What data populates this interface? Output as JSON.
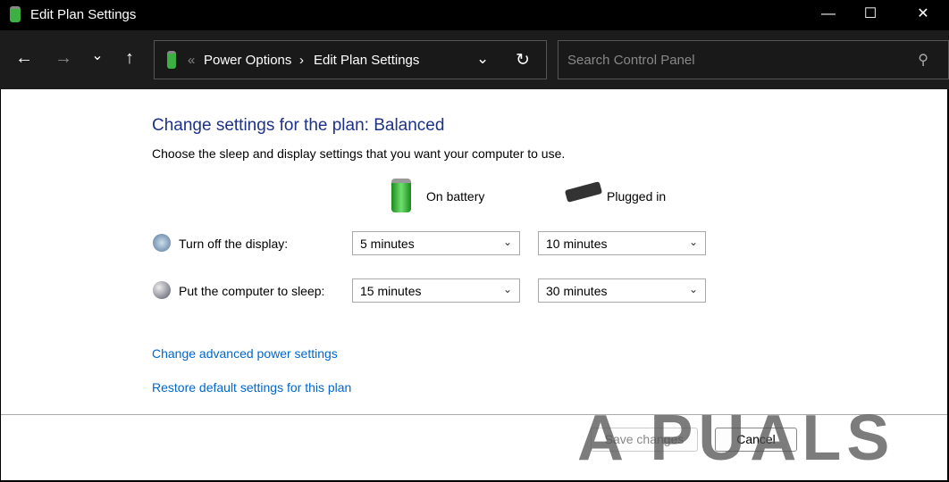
{
  "window": {
    "title": "Edit Plan Settings",
    "minimize": "—",
    "maximize": "☐",
    "close": "✕"
  },
  "nav": {
    "back": "←",
    "forward": "→",
    "recent": "⌄",
    "up": "↑",
    "refresh": "↻",
    "dropdown": "⌄"
  },
  "address": {
    "sep": "«",
    "crumbs": [
      "Power Options",
      "Edit Plan Settings"
    ],
    "arrow": "›"
  },
  "search": {
    "placeholder": "Search Control Panel",
    "icon": "⚲"
  },
  "main": {
    "title": "Change settings for the plan: Balanced",
    "description": "Choose the sleep and display settings that you want your computer to use.",
    "columns": [
      "On battery",
      "Plugged in"
    ],
    "rows": [
      {
        "label": "Turn off the display:",
        "battery": "5 minutes",
        "plugged": "10 minutes"
      },
      {
        "label": "Put the computer to sleep:",
        "battery": "15 minutes",
        "plugged": "30 minutes"
      }
    ],
    "links": [
      "Change advanced power settings",
      "Restore default settings for this plan"
    ],
    "save": "Save changes",
    "cancel": "Cancel"
  },
  "watermark": "APPUALS",
  "colors": {
    "title": "#1e3287",
    "link": "#0066cc"
  }
}
